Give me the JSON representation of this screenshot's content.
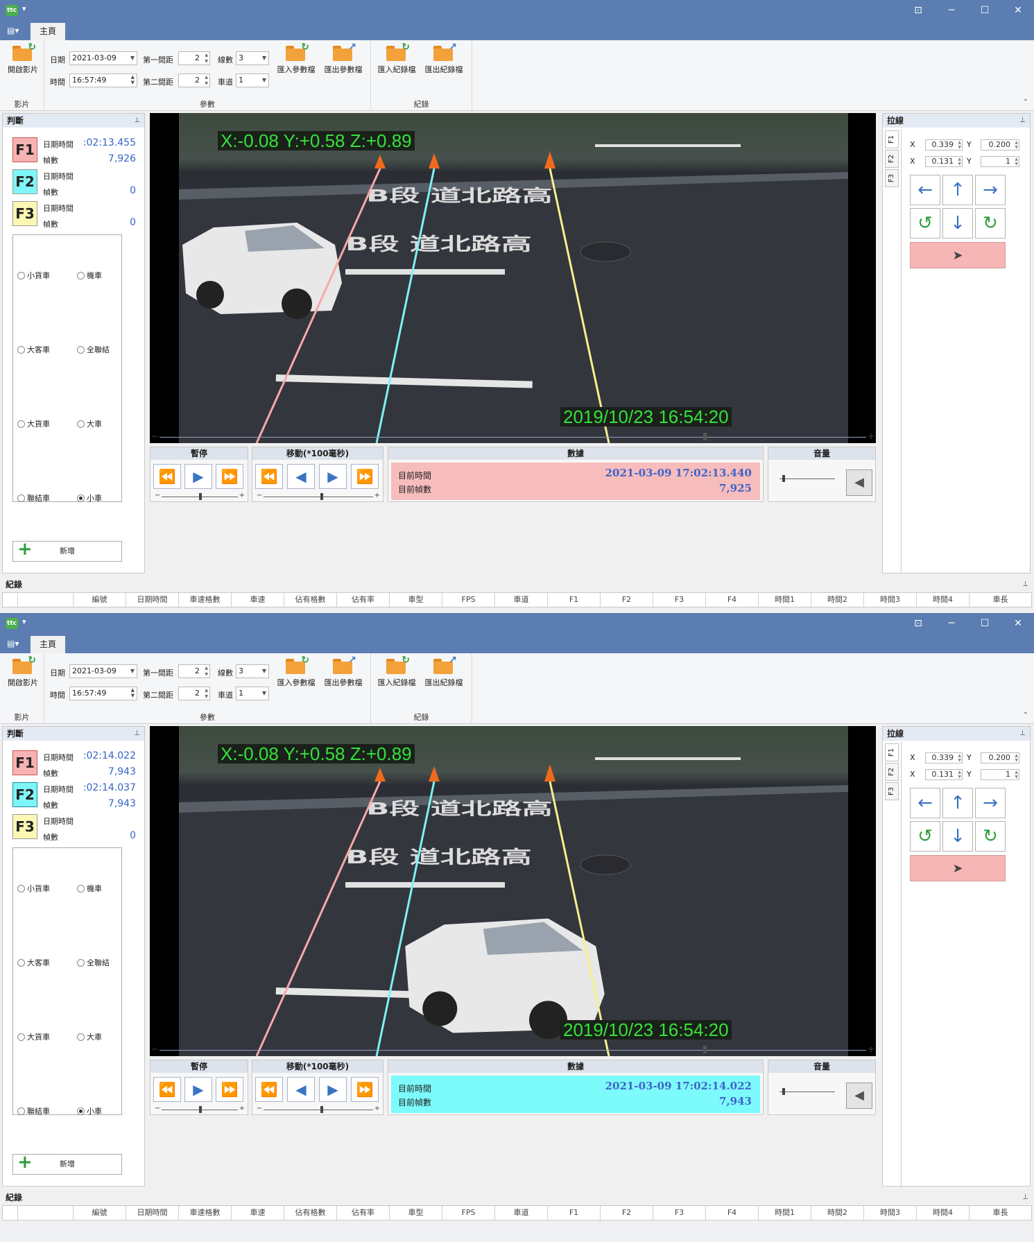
{
  "window": {
    "app_icon": "ttc",
    "quick_access": "▾",
    "controls": [
      "⊡",
      "─",
      "☐",
      "✕"
    ]
  },
  "ribbon": {
    "app_menu": "▤▾",
    "tab_home": "主頁",
    "open_video": "開啟影片",
    "group_video": "影片",
    "date_label": "日期",
    "date_value": "2021-03-09",
    "time_label": "時間",
    "time_value": "16:57:49",
    "gap1_label": "第一間距",
    "gap1_value": "2",
    "gap2_label": "第二間距",
    "gap2_value": "2",
    "lines_label": "線數",
    "lines_value": "3",
    "lane_label": "車道",
    "lane_value": "1",
    "import_params": "匯入參數檔",
    "export_params": "匯出參數檔",
    "group_params": "參數",
    "import_log": "匯入紀錄檔",
    "export_log": "匯出紀錄檔",
    "group_log": "紀錄"
  },
  "judge": {
    "title": "判斷",
    "f_labels": [
      "F1",
      "F2",
      "F3"
    ],
    "dt_label": "日期時間",
    "frames_label": "幀數",
    "radios": [
      "小貨車",
      "機車",
      "大客車",
      "全聯結",
      "大貨車",
      "大車",
      "聯結車",
      "小車"
    ],
    "add": "新增"
  },
  "overlay": {
    "xyz": "X:-0.08 Y:+0.58 Z:+0.89",
    "timestamp": "2019/10/23 16:54:20"
  },
  "controls": {
    "pause": "暫停",
    "move": "移動(*100毫秒)",
    "data": "數據",
    "volume": "音量",
    "cur_time_label": "目前時間",
    "cur_frame_label": "目前幀數",
    "minus": "−",
    "plus": "+"
  },
  "pull": {
    "title": "拉線",
    "tabs": [
      "F1",
      "F2",
      "F3"
    ],
    "x1": "0.339",
    "y1": "0.200",
    "x2": "0.131",
    "y2": "1",
    "x_label": "X",
    "y_label": "Y"
  },
  "log": {
    "title": "紀錄",
    "columns": [
      "編號",
      "日期時間",
      "車速格數",
      "車速",
      "佔有格數",
      "佔有率",
      "車型",
      "FPS",
      "車道",
      "F1",
      "F2",
      "F3",
      "F4",
      "時間1",
      "時間2",
      "時間3",
      "時間4",
      "車長"
    ]
  },
  "states": [
    {
      "f1_time": ":02:13.455",
      "f1_frames": "7,926",
      "f2_time": "",
      "f2_frames": "0",
      "f3_time": "",
      "f3_frames": "0",
      "cur_time": "2021-03-09 17:02:13.440",
      "cur_frame": "7,925",
      "data_color": "#f7bcbc"
    },
    {
      "f1_time": ":02:14.022",
      "f1_frames": "7,943",
      "f2_time": ":02:14.037",
      "f2_frames": "7,943",
      "f3_time": "",
      "f3_frames": "0",
      "cur_time": "2021-03-09 17:02:14.022",
      "cur_frame": "7,943",
      "data_color": "#7dfafc"
    }
  ],
  "colors": {
    "f1": "#f7b3b3",
    "f2": "#7ef6f8",
    "f3": "#fbf8b4",
    "line_f1": "#f8a9a9",
    "line_f2": "#7ff1f5",
    "line_f3": "#f6f08e"
  }
}
